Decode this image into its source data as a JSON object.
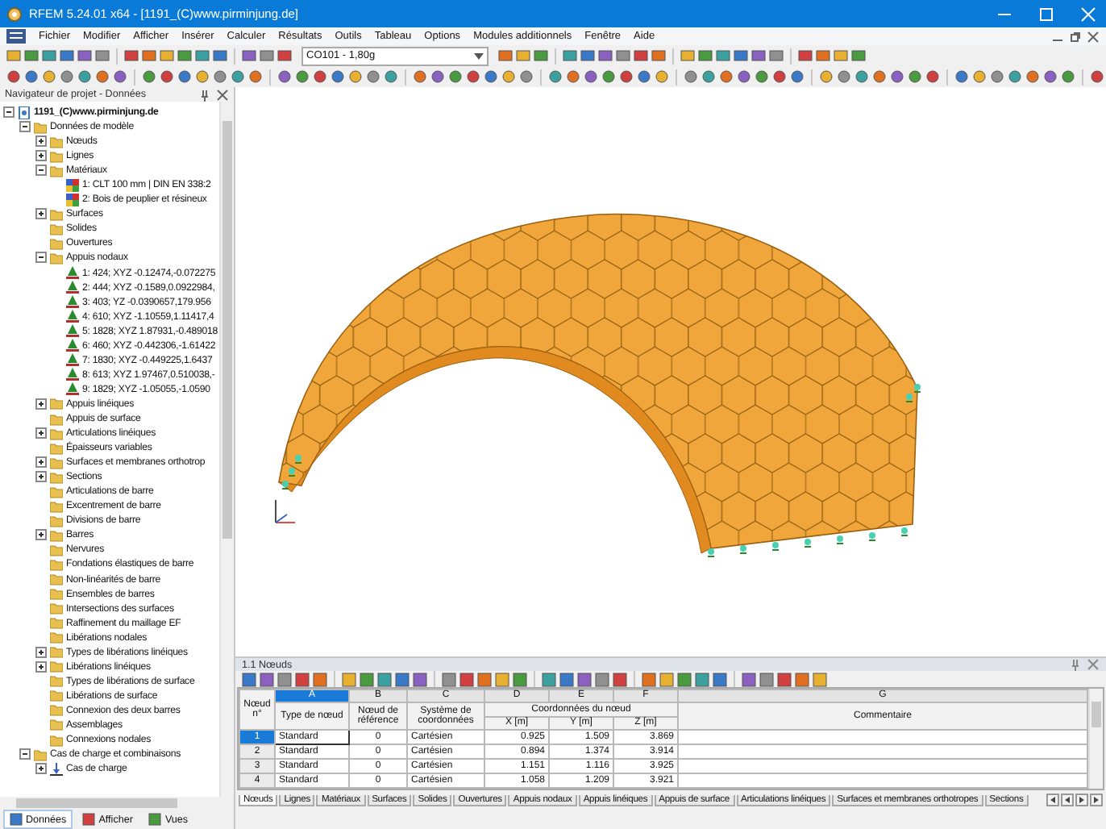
{
  "window": {
    "title": "RFEM 5.24.01 x64 - [1191_(C)www.pirminjung.de]"
  },
  "menu": [
    "Fichier",
    "Modifier",
    "Afficher",
    "Insérer",
    "Calculer",
    "Résultats",
    "Outils",
    "Tableau",
    "Options",
    "Modules additionnels",
    "Fenêtre",
    "Aide"
  ],
  "toolbar": {
    "load_combo": "CO101 - 1,80g"
  },
  "navigator": {
    "title": "Navigateur de projet - Données",
    "tree": [
      {
        "label": "1191_(C)www.pirminjung.de",
        "kind": "project",
        "expanded": true,
        "children": [
          {
            "label": "Données de modèle",
            "kind": "folder",
            "expanded": true,
            "children": [
              {
                "label": "Nœuds",
                "kind": "folder",
                "expanded": false
              },
              {
                "label": "Lignes",
                "kind": "folder",
                "expanded": false
              },
              {
                "label": "Matériaux",
                "kind": "folder",
                "expanded": true,
                "children": [
                  {
                    "label": "1: CLT 100 mm | DIN EN 338:2",
                    "kind": "material"
                  },
                  {
                    "label": "2: Bois de peuplier et résineux",
                    "kind": "material"
                  }
                ]
              },
              {
                "label": "Surfaces",
                "kind": "folder",
                "expanded": false
              },
              {
                "label": "Solides",
                "kind": "folder"
              },
              {
                "label": "Ouvertures",
                "kind": "folder"
              },
              {
                "label": "Appuis nodaux",
                "kind": "folder",
                "expanded": true,
                "children": [
                  {
                    "label": "1: 424; XYZ -0.12474,-0.072275",
                    "kind": "support"
                  },
                  {
                    "label": "2: 444; XYZ -0.1589,0.0922984,",
                    "kind": "support"
                  },
                  {
                    "label": "3: 403; YZ -0.0390657,179.956",
                    "kind": "support"
                  },
                  {
                    "label": "4: 610; XYZ -1.10559,1.11417,4",
                    "kind": "support"
                  },
                  {
                    "label": "5: 1828; XYZ 1.87931,-0.489018",
                    "kind": "support"
                  },
                  {
                    "label": "6: 460; XYZ -0.442306,-1.61422",
                    "kind": "support"
                  },
                  {
                    "label": "7: 1830; XYZ -0.449225,1.6437",
                    "kind": "support"
                  },
                  {
                    "label": "8: 613; XYZ 1.97467,0.510038,-",
                    "kind": "support"
                  },
                  {
                    "label": "9: 1829; XYZ -1.05055,-1.0590",
                    "kind": "support"
                  }
                ]
              },
              {
                "label": "Appuis linéiques",
                "kind": "folder",
                "expanded": false
              },
              {
                "label": "Appuis de surface",
                "kind": "folder"
              },
              {
                "label": "Articulations linéiques",
                "kind": "folder",
                "expanded": false
              },
              {
                "label": "Épaisseurs variables",
                "kind": "folder"
              },
              {
                "label": "Surfaces et membranes orthotrop",
                "kind": "folder",
                "expanded": false
              },
              {
                "label": "Sections",
                "kind": "folder",
                "expanded": false
              },
              {
                "label": "Articulations de barre",
                "kind": "folder"
              },
              {
                "label": "Excentrement de barre",
                "kind": "folder"
              },
              {
                "label": "Divisions de barre",
                "kind": "folder"
              },
              {
                "label": "Barres",
                "kind": "folder",
                "expanded": false
              },
              {
                "label": "Nervures",
                "kind": "folder"
              },
              {
                "label": "Fondations élastiques de barre",
                "kind": "folder"
              },
              {
                "label": "Non-linéarités de barre",
                "kind": "folder"
              },
              {
                "label": "Ensembles de barres",
                "kind": "folder"
              },
              {
                "label": "Intersections des surfaces",
                "kind": "folder"
              },
              {
                "label": "Raffinement du maillage EF",
                "kind": "folder"
              },
              {
                "label": "Libérations nodales",
                "kind": "folder"
              },
              {
                "label": "Types de libérations linéiques",
                "kind": "folder",
                "expanded": false
              },
              {
                "label": "Libérations linéiques",
                "kind": "folder",
                "expanded": false
              },
              {
                "label": "Types de libérations de surface",
                "kind": "folder"
              },
              {
                "label": "Libérations de surface",
                "kind": "folder"
              },
              {
                "label": "Connexion des deux barres",
                "kind": "folder"
              },
              {
                "label": "Assemblages",
                "kind": "folder"
              },
              {
                "label": "Connexions nodales",
                "kind": "folder"
              }
            ]
          },
          {
            "label": "Cas de charge et combinaisons",
            "kind": "folder",
            "expanded": true,
            "children": [
              {
                "label": "Cas de charge",
                "kind": "load-case",
                "expanded": false
              }
            ]
          }
        ]
      }
    ],
    "tabs": [
      {
        "label": "Données",
        "selected": true
      },
      {
        "label": "Afficher",
        "selected": false
      },
      {
        "label": "Vues",
        "selected": false
      }
    ]
  },
  "table_panel": {
    "title": "1.1 Nœuds",
    "number_heading": "Nœud n°",
    "group_heading": "Coordonnées du nœud",
    "columns": [
      {
        "letter": "A",
        "heading": "Type de nœud"
      },
      {
        "letter": "B",
        "heading": "Nœud de référence"
      },
      {
        "letter": "C",
        "heading": "Système de coordonnées"
      },
      {
        "letter": "D",
        "heading": "X [m]"
      },
      {
        "letter": "E",
        "heading": "Y [m]"
      },
      {
        "letter": "F",
        "heading": "Z [m]"
      },
      {
        "letter": "G",
        "heading": "Commentaire"
      }
    ],
    "rows": [
      {
        "no": "1",
        "selected": true,
        "cells": [
          "Standard",
          "0",
          "Cartésien",
          "0.925",
          "1.509",
          "3.869"
        ]
      },
      {
        "no": "2",
        "selected": false,
        "cells": [
          "Standard",
          "0",
          "Cartésien",
          "0.894",
          "1.374",
          "3.914"
        ]
      },
      {
        "no": "3",
        "selected": false,
        "cells": [
          "Standard",
          "0",
          "Cartésien",
          "1.151",
          "1.116",
          "3.925"
        ]
      },
      {
        "no": "4",
        "selected": false,
        "cells": [
          "Standard",
          "0",
          "Cartésien",
          "1.058",
          "1.209",
          "3.921"
        ]
      }
    ],
    "sheet_tabs": [
      {
        "label": "Nœuds",
        "selected": true
      },
      {
        "label": "Lignes",
        "selected": false
      },
      {
        "label": "Matériaux",
        "selected": false
      },
      {
        "label": "Surfaces",
        "selected": false
      },
      {
        "label": "Solides",
        "selected": false
      },
      {
        "label": "Ouvertures",
        "selected": false
      },
      {
        "label": "Appuis nodaux",
        "selected": false
      },
      {
        "label": "Appuis linéiques",
        "selected": false
      },
      {
        "label": "Appuis de surface",
        "selected": false
      },
      {
        "label": "Articulations linéiques",
        "selected": false
      },
      {
        "label": "Surfaces et membranes orthotropes",
        "selected": false
      },
      {
        "label": "Sections",
        "selected": false
      }
    ]
  }
}
